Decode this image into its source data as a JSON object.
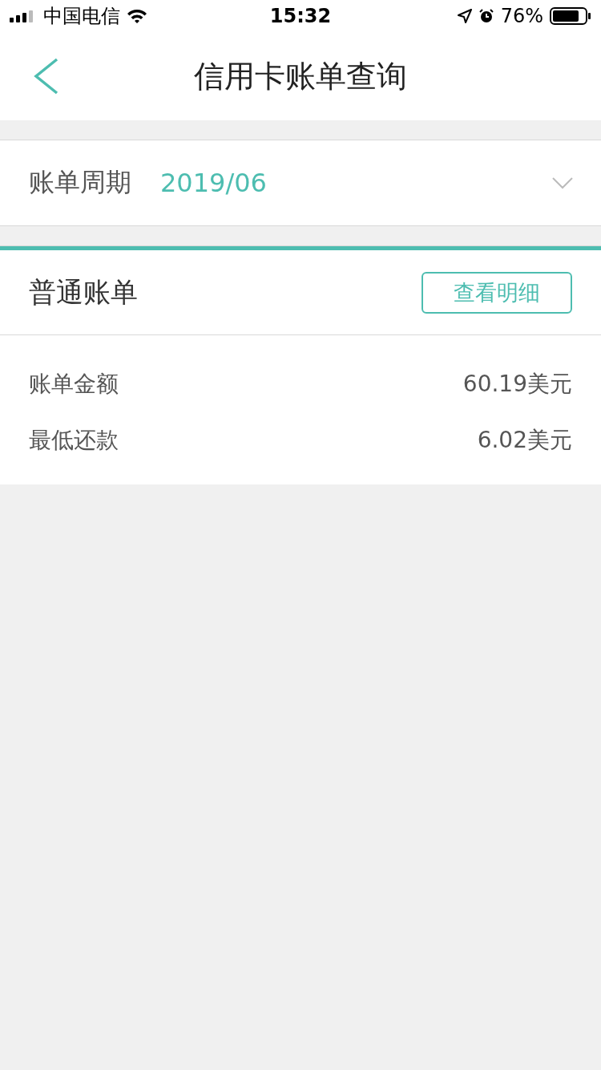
{
  "status_bar": {
    "carrier": "中国电信",
    "time": "15:32",
    "battery": "76%"
  },
  "nav": {
    "title": "信用卡账单查询"
  },
  "period": {
    "label": "账单周期",
    "value": "2019/06"
  },
  "bill": {
    "title": "普通账单",
    "button": "查看明细",
    "rows": [
      {
        "label": "账单金额",
        "value": "60.19美元"
      },
      {
        "label": "最低还款",
        "value": "6.02美元"
      }
    ]
  }
}
